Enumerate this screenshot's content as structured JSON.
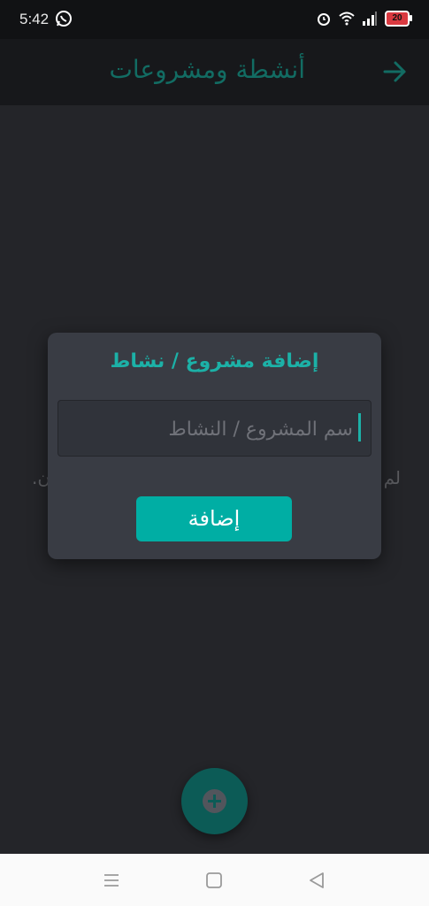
{
  "status_bar": {
    "time": "5:42",
    "battery": "20",
    "icons": [
      "whatsapp-icon",
      "alarm-icon",
      "wifi-icon",
      "signal-icon",
      "battery-icon"
    ]
  },
  "app_bar": {
    "title": "أنشطة ومشروعات",
    "back_icon": "arrow-right-icon"
  },
  "empty_state": {
    "text_left_fragment": "لم",
    "text_right_fragment": "ن."
  },
  "dialog": {
    "title": "إضافة مشروع / نشاط",
    "input_placeholder": "سم المشروع / النشاط",
    "add_button_label": "إضافة"
  },
  "fab": {
    "icon": "plus-circle-icon"
  },
  "nav_bar": {
    "icons": [
      "menu-icon",
      "home-square-icon",
      "back-triangle-icon"
    ]
  },
  "colors": {
    "accent": "#00aea4",
    "dialog_title": "#1cb1a7",
    "app_title": "#126c63",
    "background": "#242529",
    "dialog_bg": "#393c44"
  }
}
